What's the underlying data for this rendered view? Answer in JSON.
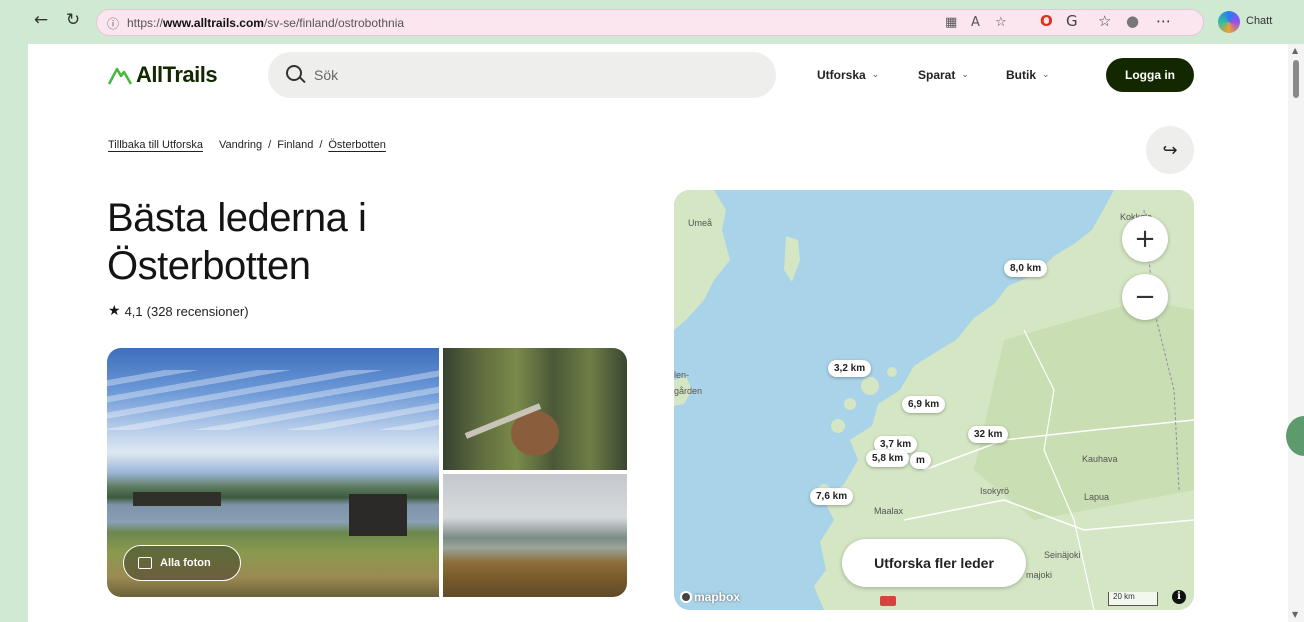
{
  "browser": {
    "url_prefix": "https://",
    "url_domain": "www.alltrails.com",
    "url_path": "/sv-se/finland/ostrobothnia",
    "chat_label": "Chatt"
  },
  "header": {
    "logo_text": "AllTrails",
    "search_placeholder": "Sök",
    "nav": [
      {
        "label": "Utforska"
      },
      {
        "label": "Sparat"
      },
      {
        "label": "Butik"
      }
    ],
    "login_label": "Logga in"
  },
  "breadcrumb": {
    "back": "Tillbaka till Utforska",
    "activity": "Vandring",
    "sep": "/",
    "country": "Finland",
    "region": "Österbotten"
  },
  "page": {
    "title": "Bästa lederna i Österbotten",
    "rating": "4,1",
    "reviews": "(328 recensioner)",
    "all_photos_label": "Alla foton"
  },
  "map": {
    "distances": [
      "8,0 km",
      "3,2 km",
      "6,9 km",
      "32 km",
      "5,8 km",
      "7,6 km"
    ],
    "partial_labels": [
      "3,7 km",
      "m"
    ],
    "places": [
      "Umeå",
      "Kokkola",
      "len-",
      "gården",
      "Kauhava",
      "Isokyrö",
      "Lapua",
      "Seinäjoki",
      "majoki",
      "Maalax"
    ],
    "explore_label": "Utforska fler leder",
    "attribution": "mapbox",
    "scale_label": "20 km",
    "colors": {
      "water": "#a9d3e8",
      "land": "#d4e6c4",
      "forest": "#bfd9a8"
    }
  }
}
